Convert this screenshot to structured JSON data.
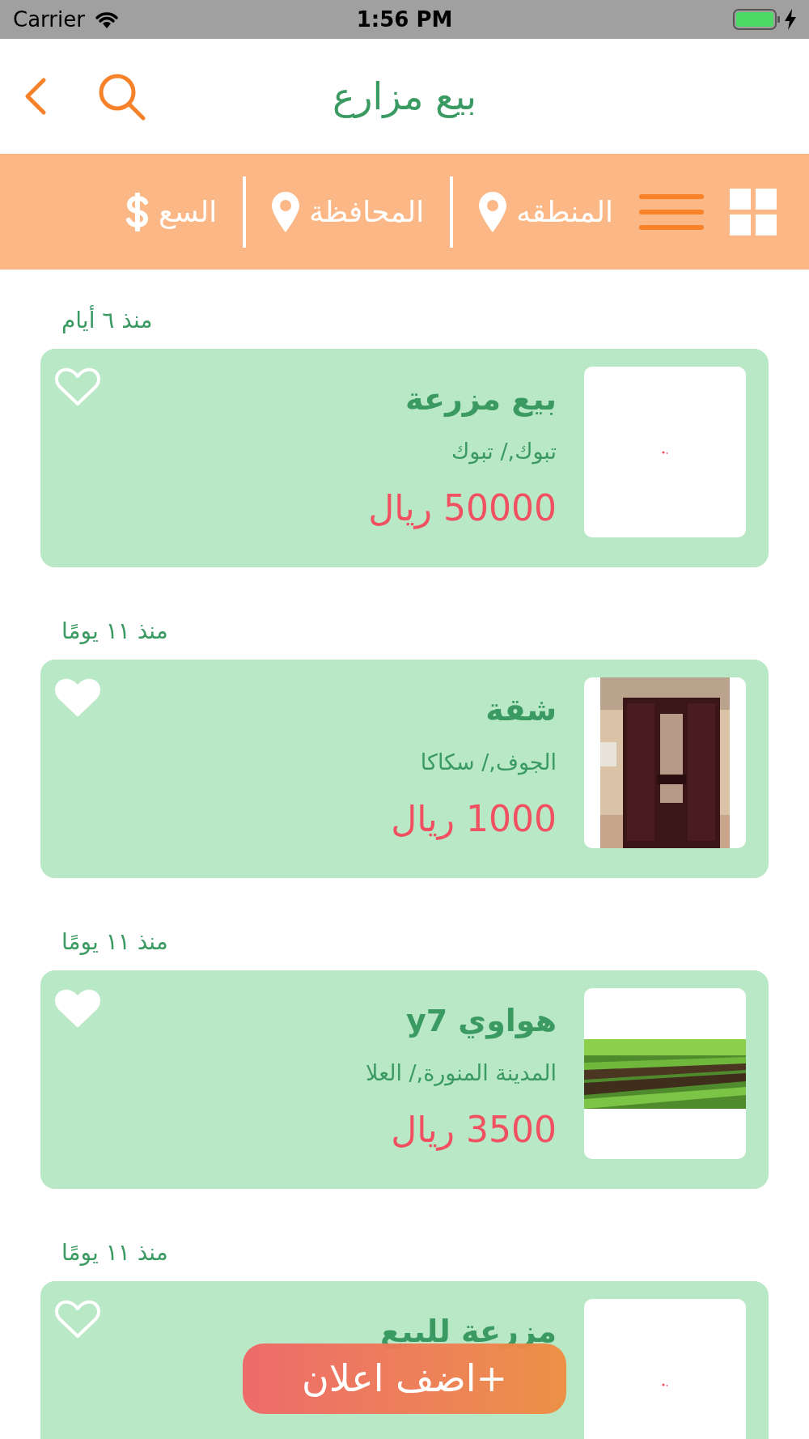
{
  "status_bar": {
    "carrier": "Carrier",
    "time": "1:56 PM",
    "charging": true
  },
  "nav": {
    "title": "بيع مزارع"
  },
  "filters": [
    {
      "kind": "grid"
    },
    {
      "kind": "menu"
    },
    {
      "kind": "pin",
      "label": "المنطقه"
    },
    {
      "kind": "pin",
      "label": "المحافظة"
    },
    {
      "kind": "dollar",
      "label": "السع"
    }
  ],
  "listings": [
    {
      "posted": "منذ ٦ أيام",
      "title": "بيع مزرعة",
      "location": "تبوك,/ تبوك",
      "price": "50000 ريال",
      "favorite": false
    },
    {
      "posted": "منذ ١١ يومًا",
      "title": "شقة",
      "location": "الجوف,/ سكاكا",
      "price": "1000 ريال",
      "favorite": true
    },
    {
      "posted": "منذ ١١ يومًا",
      "title": "هواوي y7",
      "location": "المدينة المنورة,/ العلا",
      "price": "3500 ريال",
      "favorite": true
    },
    {
      "posted": "منذ ١١ يومًا",
      "title": "مزرعة للبيع",
      "favorite": false
    }
  ],
  "add_button": {
    "label": "+اضف اعلان"
  }
}
